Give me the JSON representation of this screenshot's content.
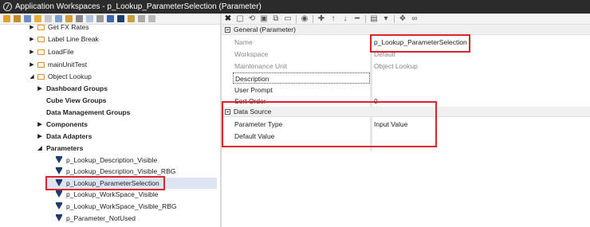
{
  "window": {
    "title": "Application Workspaces - p_Lookup_ParameterSelection (Parameter)"
  },
  "tree": {
    "items": [
      {
        "label": "Get FX Rates"
      },
      {
        "label": "Label Line Break"
      },
      {
        "label": "LoadFile"
      },
      {
        "label": "mainUnitTest"
      },
      {
        "label": "Object Lookup"
      },
      {
        "label": "Dashboard Groups"
      },
      {
        "label": "Cube View Groups"
      },
      {
        "label": "Data Management Groups"
      },
      {
        "label": "Components"
      },
      {
        "label": "Data Adapters"
      },
      {
        "label": "Parameters"
      },
      {
        "label": "p_Lookup_Description_Visible"
      },
      {
        "label": "p_Lookup_Description_Visible_RBG"
      },
      {
        "label": "p_Lookup_ParameterSelection"
      },
      {
        "label": "p_Lookup_WorkSpace_Visible"
      },
      {
        "label": "p_Lookup_WorkSpace_Visible_RBG"
      },
      {
        "label": "p_Parameter_NotUsed"
      }
    ]
  },
  "properties": {
    "general_header": "General (Parameter)",
    "general": [
      {
        "name": "Name",
        "value": "p_Lookup_ParameterSelection"
      },
      {
        "name": "Workspace",
        "value": "Default"
      },
      {
        "name": "Maintenance Unit",
        "value": "Object Lookup"
      },
      {
        "name": "Description",
        "value": ""
      },
      {
        "name": "User Prompt",
        "value": ""
      },
      {
        "name": "Sort Order",
        "value": "0"
      }
    ],
    "datasource_header": "Data Source",
    "datasource": [
      {
        "name": "Parameter Type",
        "value": "Input Value"
      },
      {
        "name": "Default Value",
        "value": ""
      }
    ]
  },
  "colors": {
    "highlight": "#d9252b",
    "selection": "#dde4f3",
    "titlebar": "#2b2b2b"
  }
}
